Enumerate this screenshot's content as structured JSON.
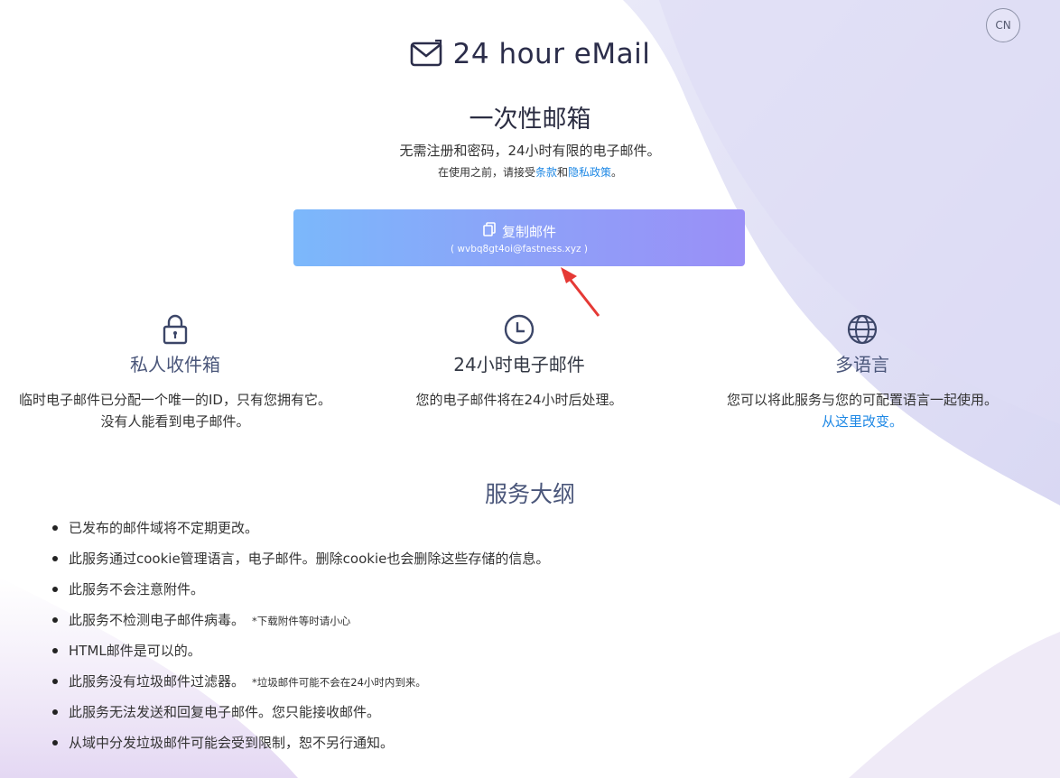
{
  "header": {
    "lang_button": "CN",
    "logo_text": "24 hour eMail"
  },
  "hero": {
    "title": "一次性邮箱",
    "subtitle": "无需注册和密码，24小时有限的电子邮件。",
    "terms_prefix": "在使用之前，请接受",
    "terms_link": "条款",
    "terms_and": "和",
    "privacy_link": "隐私政策",
    "terms_suffix": "。"
  },
  "copy_button": {
    "label": "复制邮件",
    "email": "( wvbq8gt4oi@fastness.xyz )"
  },
  "features": [
    {
      "icon": "lock-icon",
      "title": "私人收件箱",
      "text": "临时电子邮件已分配一个唯一的ID，只有您拥有它。没有人能看到电子邮件。"
    },
    {
      "icon": "clock-icon",
      "title": "24小时电子邮件",
      "text": "您的电子邮件将在24小时后处理。"
    },
    {
      "icon": "globe-icon",
      "title": "多语言",
      "text": "您可以将此服务与您的可配置语言一起使用。",
      "link": "从这里改变。"
    }
  ],
  "outline": {
    "title": "服务大纲",
    "items": [
      {
        "text": "已发布的邮件域将不定期更改。",
        "note": ""
      },
      {
        "text": "此服务通过cookie管理语言，电子邮件。删除cookie也会删除这些存储的信息。",
        "note": ""
      },
      {
        "text": "此服务不会注意附件。",
        "note": ""
      },
      {
        "text": "此服务不检测电子邮件病毒。",
        "note": "*下载附件等时请小心"
      },
      {
        "text": "HTML邮件是可以的。",
        "note": ""
      },
      {
        "text": "此服务没有垃圾邮件过滤器。",
        "note": "*垃圾邮件可能不会在24小时内到来。"
      },
      {
        "text": "此服务无法发送和回复电子邮件。您只能接收邮件。",
        "note": ""
      },
      {
        "text": "从域中分发垃圾邮件可能会受到限制，恕不另行通知。",
        "note": ""
      }
    ]
  },
  "colors": {
    "accent_link": "#1e88e5",
    "button_gradient_start": "#7bb8fb",
    "button_gradient_end": "#9a8ff7",
    "heading": "#4a567a",
    "arrow": "#e53935"
  }
}
